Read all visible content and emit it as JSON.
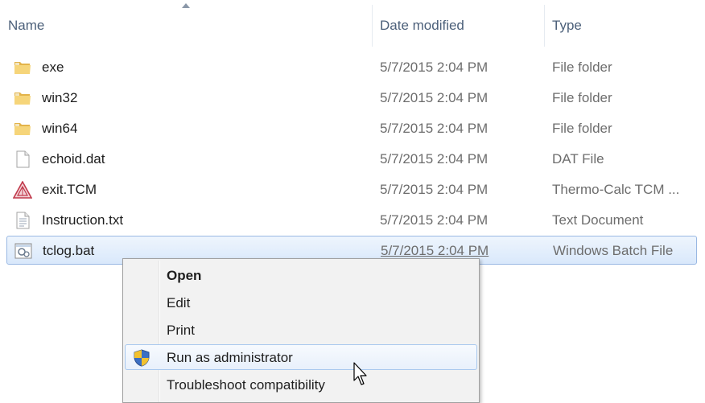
{
  "columns": {
    "name": "Name",
    "date_modified": "Date modified",
    "type": "Type"
  },
  "files": [
    {
      "name": "exe",
      "date": "5/7/2015 2:04 PM",
      "type": "File folder",
      "icon": "folder-icon"
    },
    {
      "name": "win32",
      "date": "5/7/2015 2:04 PM",
      "type": "File folder",
      "icon": "folder-icon"
    },
    {
      "name": "win64",
      "date": "5/7/2015 2:04 PM",
      "type": "File folder",
      "icon": "folder-icon"
    },
    {
      "name": "echoid.dat",
      "date": "5/7/2015 2:04 PM",
      "type": "DAT File",
      "icon": "blank-file-icon"
    },
    {
      "name": "exit.TCM",
      "date": "5/7/2015 2:04 PM",
      "type": "Thermo-Calc TCM ...",
      "icon": "thermocalc-file-icon"
    },
    {
      "name": "Instruction.txt",
      "date": "5/7/2015 2:04 PM",
      "type": "Text Document",
      "icon": "text-file-icon"
    },
    {
      "name": "tclog.bat",
      "date": "5/7/2015 2:04 PM",
      "type": "Windows Batch File",
      "icon": "batch-file-icon",
      "selected": true
    }
  ],
  "context_menu": {
    "items": [
      {
        "label": "Open",
        "bold": true
      },
      {
        "label": "Edit"
      },
      {
        "label": "Print"
      },
      {
        "label": "Run as administrator",
        "icon": "uac-shield-icon",
        "hovered": true
      },
      {
        "label": "Troubleshoot compatibility"
      }
    ]
  }
}
